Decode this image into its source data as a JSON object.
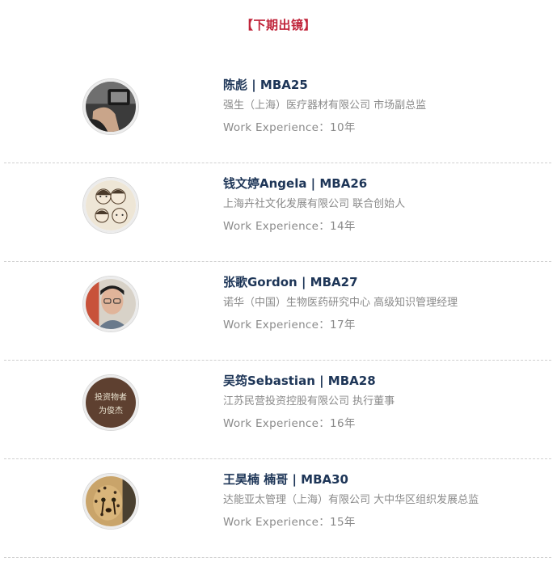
{
  "section_title": "【下期出镜】",
  "people": [
    {
      "name": "陈彪 | MBA25",
      "company": "强生（上海）医疗器材有限公司 市场副总监",
      "experience": "Work Experience：10年"
    },
    {
      "name": "钱文婷Angela | MBA26",
      "company": "上海卉社文化发展有限公司 联合创始人",
      "experience": "Work Experience：14年"
    },
    {
      "name": "张歌Gordon | MBA27",
      "company": "诺华（中国）生物医药研究中心 高级知识管理经理",
      "experience": "Work Experience：17年"
    },
    {
      "name": "吴筠Sebastian | MBA28",
      "company": "江苏民营投资控股有限公司 执行董事",
      "experience": "Work Experience：16年"
    },
    {
      "name": "王昊楠 楠哥 | MBA30",
      "company": "达能亚太管理（上海）有限公司 大中华区组织发展总监",
      "experience": "Work Experience：15年"
    }
  ],
  "avatar_3_text": [
    "投资物者",
    "为俊杰"
  ]
}
